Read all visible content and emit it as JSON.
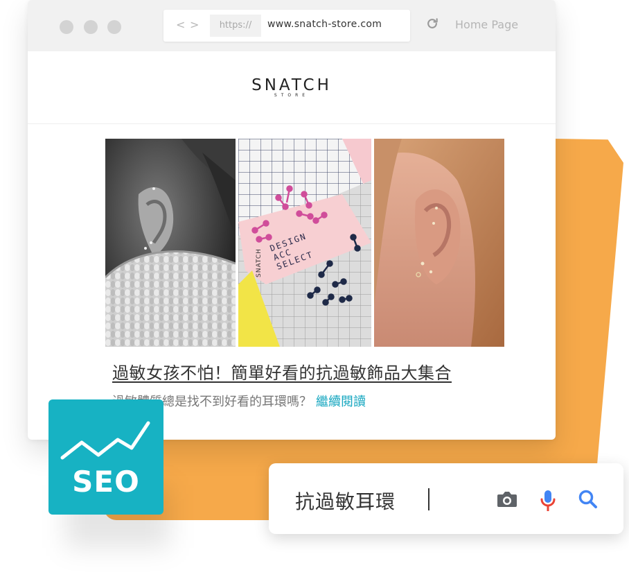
{
  "browser": {
    "protocol": "https://",
    "url": "www.snatch-store.com",
    "home_label": "Home Page",
    "nav_back": "<",
    "nav_forward": ">"
  },
  "site": {
    "logo_main": "SNATCH",
    "logo_sub": "STORE"
  },
  "article": {
    "headline": "過敏女孩不怕！簡單好看的抗過敏飾品大集合",
    "excerpt": "過敏體質總是找不到好看的耳環嗎？",
    "read_more": "繼續閱讀",
    "card_text": [
      "SNATCH",
      "DESIGN",
      "ACC",
      "SELECT"
    ]
  },
  "badge": {
    "label": "SEO"
  },
  "search": {
    "query": "抗過敏耳環"
  },
  "colors": {
    "accent": "#17b2c3",
    "orange": "#f6a94a",
    "link": "#17a7c0",
    "google_blue": "#4285f4",
    "google_red": "#ea4335"
  },
  "icons": [
    "back-icon",
    "forward-icon",
    "reload-icon",
    "camera-icon",
    "microphone-icon",
    "search-icon",
    "chart-line-icon"
  ]
}
